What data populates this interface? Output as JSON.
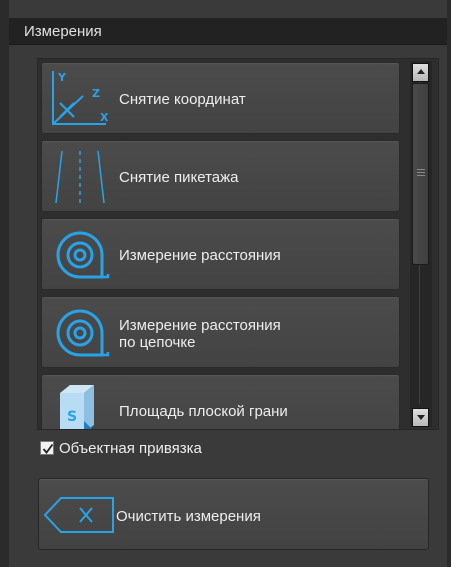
{
  "panel": {
    "title": "Измерения"
  },
  "tools": [
    {
      "label": "Снятие координат",
      "icon": "coordinates-axes-icon"
    },
    {
      "label": "Снятие пикетажа",
      "icon": "chainage-road-icon"
    },
    {
      "label": "Измерение расстояния",
      "icon": "tape-measure-icon"
    },
    {
      "label": "Измерение расстояния",
      "label2": "по цепочке",
      "icon": "tape-measure-chain-icon"
    },
    {
      "label": "Площадь плоской грани",
      "icon": "flat-face-area-icon"
    }
  ],
  "snap": {
    "label": "Объектная привязка",
    "checked": true
  },
  "clear": {
    "label": "Очистить измерения",
    "icon": "clear-backspace-icon"
  },
  "colors": {
    "accent": "#29a3e8",
    "background": "#3a3a3a",
    "title_bar": "#222222",
    "button": "#474747"
  }
}
